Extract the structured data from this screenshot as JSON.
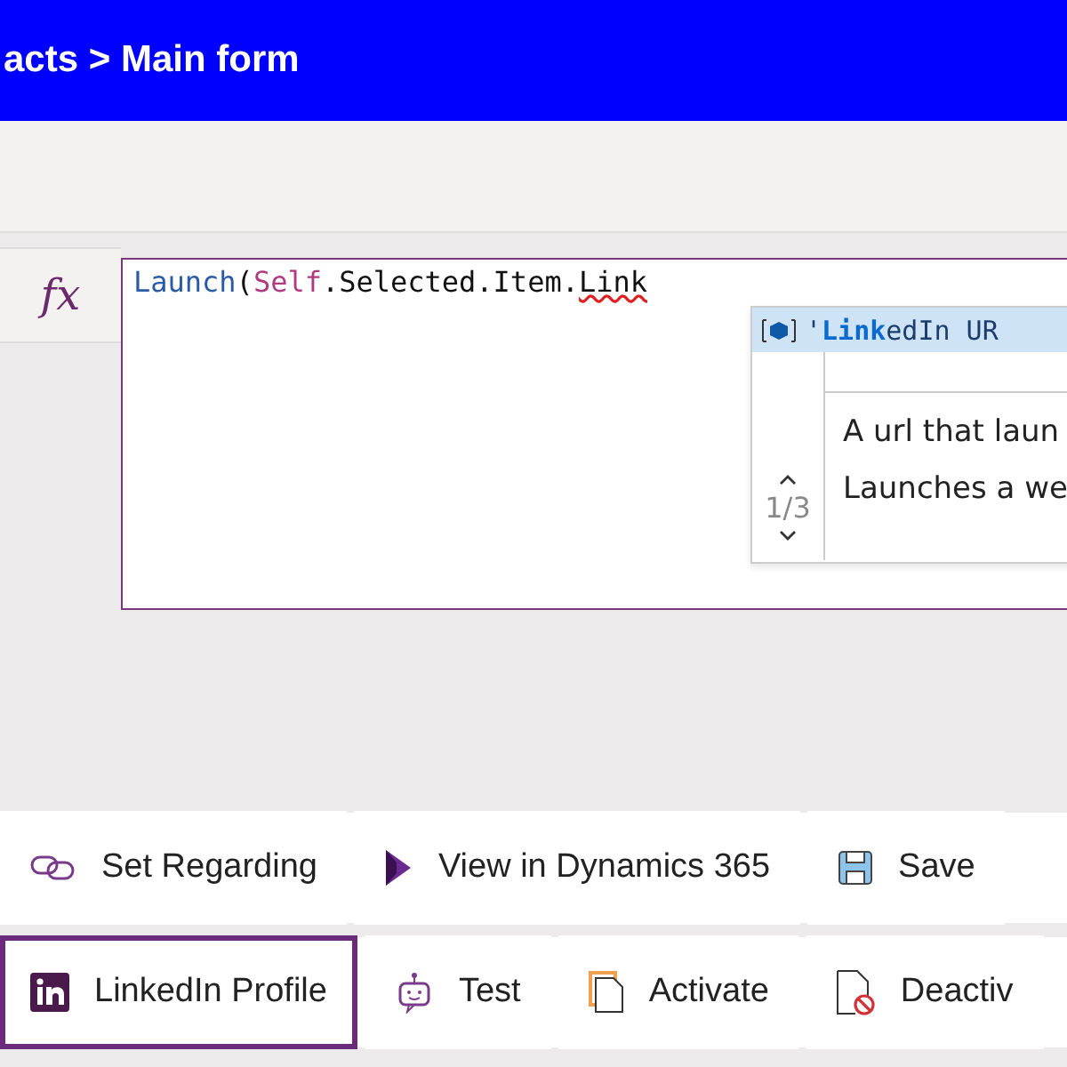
{
  "header": {
    "title": "acts > Main form"
  },
  "formula_bar": {
    "label": "fx",
    "tokens": [
      {
        "text": "Launch",
        "kind": "function"
      },
      {
        "text": "(",
        "kind": "plain"
      },
      {
        "text": "Self",
        "kind": "keyword"
      },
      {
        "text": ".Selected.Item.",
        "kind": "plain"
      },
      {
        "text": "Link",
        "kind": "error"
      }
    ]
  },
  "suggestion": {
    "text": "'**Link**edIn UR",
    "counter": "1/3",
    "description": [
      "A url that laun",
      "Launches a we"
    ]
  },
  "command_rows": [
    [
      {
        "label": "Set Regarding",
        "kind": "link",
        "selected": false
      },
      {
        "label": "View in Dynamics 365",
        "kind": "dynamics",
        "selected": false
      },
      {
        "label": "Save",
        "kind": "save",
        "selected": false
      }
    ],
    [
      {
        "label": "LinkedIn Profile",
        "kind": "linkedin",
        "selected": true
      },
      {
        "label": "Test",
        "kind": "bot",
        "selected": false
      },
      {
        "label": "Activate",
        "kind": "activate",
        "selected": false
      },
      {
        "label": "Deactiv",
        "kind": "deactivate",
        "selected": false
      }
    ]
  ]
}
